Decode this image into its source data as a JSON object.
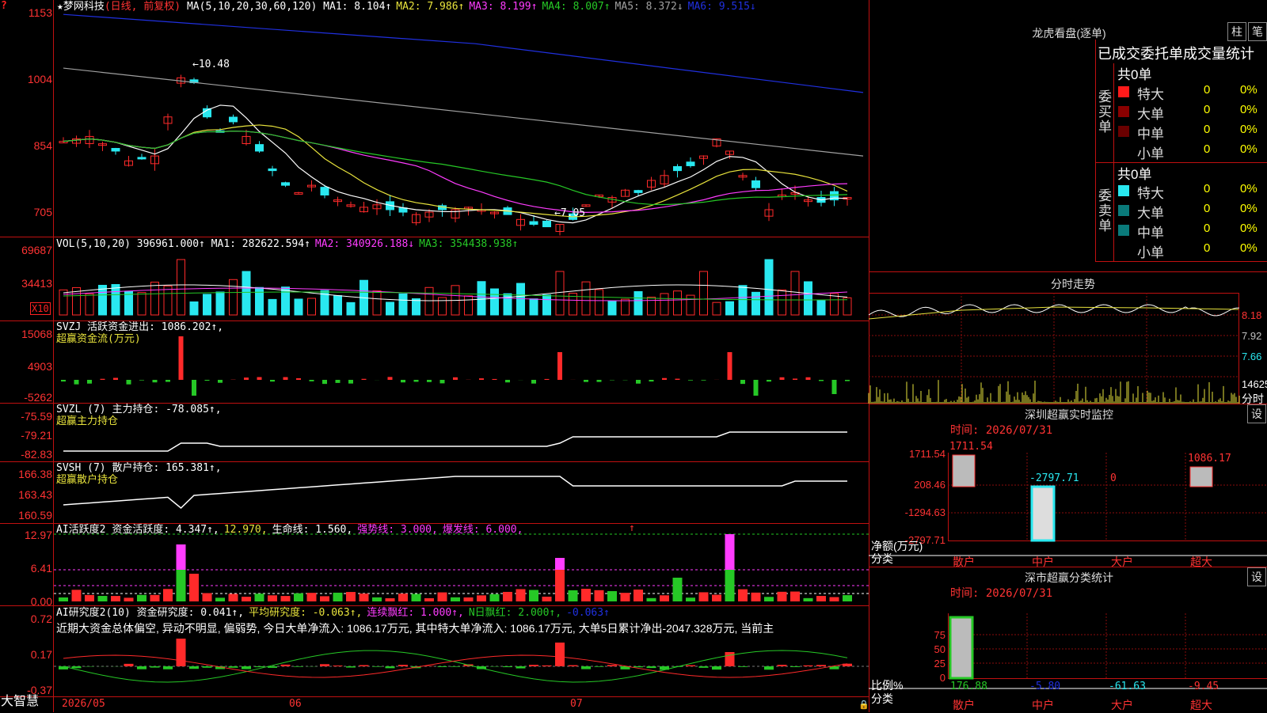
{
  "colors": {
    "up": "#ff2a2a",
    "down": "#29e8f0",
    "border": "#d01818",
    "ma1": "#ffffff",
    "ma2": "#e8e33c",
    "ma3": "#ff3cff",
    "ma4": "#26c826",
    "ma5": "#a0a0a0",
    "ma6": "#2030e0"
  },
  "main": {
    "corner_marker": "?",
    "title": "★梦网科技",
    "period": "(日线, 前复权)",
    "ma_spec": "MA(5,10,20,30,60,120)",
    "ma_values": [
      {
        "label": "MA1: 8.104↑",
        "color": "#ffffff"
      },
      {
        "label": "MA2: 7.986↑",
        "color": "#e8e33c"
      },
      {
        "label": "MA3: 8.199↑",
        "color": "#ff3cff"
      },
      {
        "label": "MA4: 8.007↑",
        "color": "#26c826"
      },
      {
        "label": "MA5: 8.372↓",
        "color": "#a0a0a0"
      },
      {
        "label": "MA6: 9.515↓",
        "color": "#2030e0"
      }
    ],
    "y_ticks": [
      "1153",
      "1004",
      "854",
      "705"
    ],
    "high_annot": "10.48",
    "low_annot": "7.05"
  },
  "vol": {
    "spec": "VOL(5,10,20)",
    "value": "396961.000↑",
    "ma": [
      {
        "label": "MA1: 282622.594↑",
        "color": "#ffffff"
      },
      {
        "label": "MA2: 340926.188↓",
        "color": "#ff3cff"
      },
      {
        "label": "MA3: 354438.938↑",
        "color": "#26c826"
      }
    ],
    "y_ticks": [
      "69687",
      "34413"
    ],
    "unit": "X10"
  },
  "svzj": {
    "spec": "SVZJ",
    "label": "活跃资金进出: 1086.202↑,",
    "sub": "超赢资金流(万元)",
    "y_ticks": [
      "15068",
      "4903",
      "-5262"
    ]
  },
  "svzl": {
    "spec": "SVZL (7)",
    "label": "主力持仓: -78.085↑,",
    "sub": "超赢主力持仓",
    "y_ticks": [
      "-75.59",
      "-79.21",
      "-82.83"
    ]
  },
  "svsh": {
    "spec": "SVSH (7)",
    "label": "散户持仓: 165.381↑,",
    "sub": "超赢散户持仓",
    "y_ticks": [
      "166.38",
      "163.43",
      "160.59"
    ]
  },
  "ai2": {
    "spec": "AI活跃度2",
    "items": [
      {
        "label": "资金活跃度: 4.347↑,",
        "color": "#ffffff"
      },
      {
        "label": "12.970,",
        "color": "#e8e33c"
      },
      {
        "label": "生命线: 1.560,",
        "color": "#ffffff"
      },
      {
        "label": "强势线: 3.000,",
        "color": "#ff3cff"
      },
      {
        "label": "爆发线: 6.000,",
        "color": "#ff3cff"
      }
    ],
    "y_ticks": [
      "12.97",
      "6.41",
      "0.00"
    ]
  },
  "research": {
    "spec": "AI研究度2(10)",
    "items": [
      {
        "label": "资金研究度: 0.041↑,",
        "color": "#ffffff"
      },
      {
        "label": "平均研究度: -0.063↑,",
        "color": "#e8e33c"
      },
      {
        "label": "连续飘红: 1.000↑,",
        "color": "#ff3cff"
      },
      {
        "label": "N日飘红: 2.000↑,",
        "color": "#26c826"
      },
      {
        "label": "-0.063↑",
        "color": "#2030e0"
      }
    ],
    "note": "近期大资金总体偏空, 异动不明显, 偏弱势, 今日大单净流入: 1086.17万元, 其中特大单净流入: 1086.17万元, 大单5日累计净出-2047.328万元, 当前主",
    "y_ticks": [
      "0.72",
      "0.17",
      "-0.37"
    ]
  },
  "xaxis": {
    "brand": "大智慧",
    "dates": [
      "2026/05",
      "06",
      "07"
    ]
  },
  "right": {
    "title": "龙虎看盘(逐单)",
    "btn_zhu": "柱",
    "btn_bi": "笔",
    "section_title": "已成交委托单成交量统计",
    "buy_label": "委买单",
    "sell_label": "委卖单",
    "buy_total": "共0单",
    "sell_total": "共0单",
    "buy_rows": [
      {
        "name": "特大",
        "n": "0",
        "p": "0%",
        "c": "#ff1a1a"
      },
      {
        "name": "大单",
        "n": "0",
        "p": "0%",
        "c": "#8a0000"
      },
      {
        "name": "中单",
        "n": "0",
        "p": "0%",
        "c": "#6a0000"
      },
      {
        "name": "小单",
        "n": "0",
        "p": "0%",
        "c": ""
      }
    ],
    "sell_rows": [
      {
        "name": "特大",
        "n": "0",
        "p": "0%",
        "c": "#29e8f0"
      },
      {
        "name": "大单",
        "n": "0",
        "p": "0%",
        "c": "#0a7a7a"
      },
      {
        "name": "中单",
        "n": "0",
        "p": "0%",
        "c": "#0a7a7a"
      },
      {
        "name": "小单",
        "n": "0",
        "p": "0%",
        "c": ""
      }
    ],
    "fenshi": {
      "title": "分时走势",
      "y_ticks": [
        "8.18",
        "7.92",
        "7.66"
      ],
      "vol_tick": "14625",
      "unit": "分时"
    },
    "sz_monitor": {
      "title": "深圳超赢实时监控",
      "btn": "设",
      "time": "时间: 2026/07/31",
      "y_ticks": [
        "1711.54",
        "208.46",
        "-1294.63",
        "-2797.71"
      ],
      "bar_labels": [
        {
          "v": "1711.54",
          "c": "#ff3333"
        },
        {
          "v": "-2797.71",
          "c": "#29e8f0"
        },
        {
          "v": "0",
          "c": "#ff3333"
        },
        {
          "v": "1086.17",
          "c": "#ff3333"
        }
      ],
      "ylabel": "净额(万元)",
      "xlabel": "分类",
      "cats": [
        "散户",
        "中户",
        "大户",
        "超大"
      ]
    },
    "sz_class": {
      "title": "深市超赢分类统计",
      "btn": "设",
      "time": "时间: 2026/07/31",
      "y_ticks": [
        "75",
        "50",
        "25",
        "0"
      ],
      "vals": [
        {
          "v": "176.88",
          "c": "#26c826"
        },
        {
          "v": "-5.80",
          "c": "#2030e0"
        },
        {
          "v": "-61.63",
          "c": "#29e8f0"
        },
        {
          "v": "-9.45",
          "c": "#ff3333"
        }
      ],
      "ylabel": "比例%",
      "xlabel": "分类",
      "cats": [
        "散户",
        "中户",
        "大户",
        "超大"
      ]
    }
  }
}
